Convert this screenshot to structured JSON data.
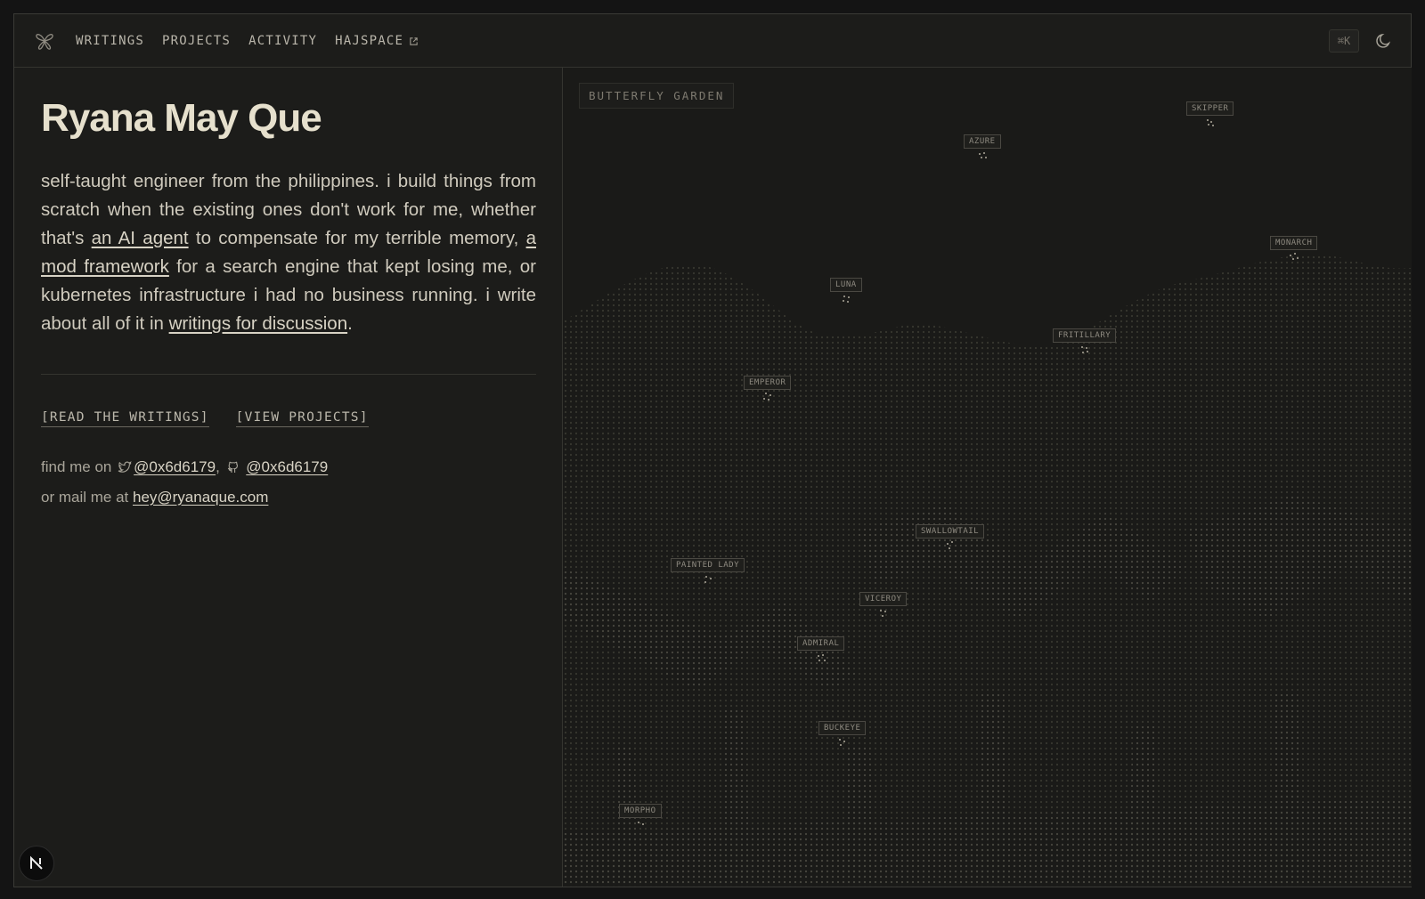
{
  "nav": {
    "links": [
      "WRITINGS",
      "PROJECTS",
      "ACTIVITY",
      "HAJSPACE"
    ],
    "shortcut": "⌘K",
    "icons": {
      "logo": "butterfly-logo-icon",
      "external": "external-link-icon",
      "theme": "moon-icon"
    }
  },
  "profile": {
    "name": "Ryana May Que",
    "bio": {
      "p1": "self-taught engineer from the philippines. i build things from scratch when the existing ones don't work for me, whether that's ",
      "link1": "an AI agent",
      "p2": " to compensate for my terrible memory, ",
      "link2": "a mod framework",
      "p3": " for a search engine that kept losing me, or kubernetes infrastructure i had no business running. i write about all of it in ",
      "link3": "writings for discussion",
      "p4": "."
    },
    "ctas": [
      "[READ THE WRITINGS]",
      "[VIEW PROJECTS]"
    ],
    "find": {
      "prefix": "find me on",
      "twitter": "@0x6d6179",
      "sep": ",",
      "github": "@0x6d6179",
      "mail_prefix": "or mail me at",
      "email": "hey@ryanaque.com"
    }
  },
  "garden": {
    "title": "BUTTERFLY GARDEN",
    "butterflies": [
      "SKIPPER",
      "AZURE",
      "MONARCH",
      "LUNA",
      "FRITILLARY",
      "EMPEROR",
      "SWALLOWTAIL",
      "PAINTED LADY",
      "VICEROY",
      "ADMIRAL",
      "BUCKEYE",
      "MORPHO"
    ]
  },
  "badge": {
    "letter": "N"
  },
  "colors": {
    "background": "#1c1c1a",
    "text": "#d4d0c4",
    "heading": "#e6e0cd",
    "border": "#34342f"
  }
}
